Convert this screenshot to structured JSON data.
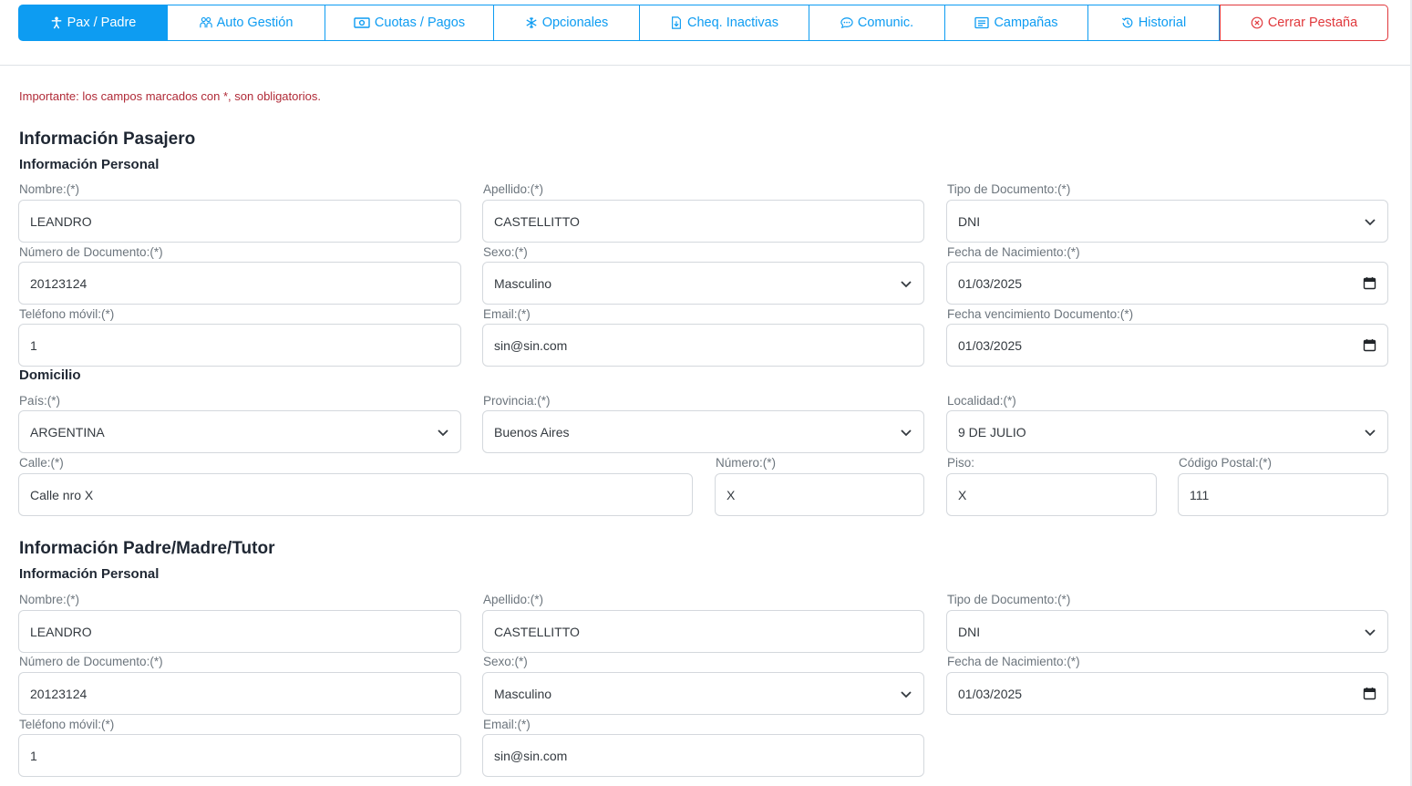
{
  "tabs": [
    {
      "label": "Pax / Padre",
      "icon": "person-icon"
    },
    {
      "label": "Auto Gestión",
      "icon": "people-icon"
    },
    {
      "label": "Cuotas / Pagos",
      "icon": "cash-icon"
    },
    {
      "label": "Opcionales",
      "icon": "snowflake-icon"
    },
    {
      "label": "Cheq. Inactivas",
      "icon": "file-download-icon"
    },
    {
      "label": "Comunic.",
      "icon": "chat-icon"
    },
    {
      "label": "Campañas",
      "icon": "card-icon"
    },
    {
      "label": "Historial",
      "icon": "history-icon"
    },
    {
      "label": "Cerrar Pestaña",
      "icon": "close-circle-icon"
    }
  ],
  "colors": {
    "accent": "#0d9cf2",
    "danger": "#e0383c",
    "required_note": "#b02a37"
  },
  "note": "Importante: los campos marcados con *, son obligatorios.",
  "pasajero": {
    "title": "Información Pasajero",
    "personal_title": "Información Personal",
    "nombre": {
      "label": "Nombre:(*)",
      "value": "LEANDRO"
    },
    "apellido": {
      "label": "Apellido:(*)",
      "value": "CASTELLITTO"
    },
    "tipo_doc": {
      "label": "Tipo de Documento:(*)",
      "value": "DNI"
    },
    "num_doc": {
      "label": "Número de Documento:(*)",
      "value": "20123124"
    },
    "sexo": {
      "label": "Sexo:(*)",
      "value": "Masculino"
    },
    "fecha_nac": {
      "label": "Fecha de Nacimiento:(*)",
      "value": "01/03/2025"
    },
    "telefono": {
      "label": "Teléfono móvil:(*)",
      "value": "1"
    },
    "email": {
      "label": "Email:(*)",
      "value": "sin@sin.com"
    },
    "fecha_venc": {
      "label": "Fecha vencimiento Documento:(*)",
      "value": "01/03/2025"
    },
    "domicilio_title": "Domicilio",
    "pais": {
      "label": "País:(*)",
      "value": "ARGENTINA"
    },
    "provincia": {
      "label": "Provincia:(*)",
      "value": "Buenos Aires"
    },
    "localidad": {
      "label": "Localidad:(*)",
      "value": "9 DE JULIO"
    },
    "calle": {
      "label": "Calle:(*)",
      "value": "Calle nro X"
    },
    "numero": {
      "label": "Número:(*)",
      "value": "X"
    },
    "piso": {
      "label": "Piso:",
      "value": "X"
    },
    "cp": {
      "label": "Código Postal:(*)",
      "value": "111"
    }
  },
  "padre": {
    "title": "Información Padre/Madre/Tutor",
    "personal_title": "Información Personal",
    "nombre": {
      "label": "Nombre:(*)",
      "value": "LEANDRO"
    },
    "apellido": {
      "label": "Apellido:(*)",
      "value": "CASTELLITTO"
    },
    "tipo_doc": {
      "label": "Tipo de Documento:(*)",
      "value": "DNI"
    },
    "num_doc": {
      "label": "Número de Documento:(*)",
      "value": "20123124"
    },
    "sexo": {
      "label": "Sexo:(*)",
      "value": "Masculino"
    },
    "fecha_nac": {
      "label": "Fecha de Nacimiento:(*)",
      "value": "01/03/2025"
    },
    "telefono": {
      "label": "Teléfono móvil:(*)",
      "value": "1"
    },
    "email": {
      "label": "Email:(*)",
      "value": "sin@sin.com"
    }
  }
}
